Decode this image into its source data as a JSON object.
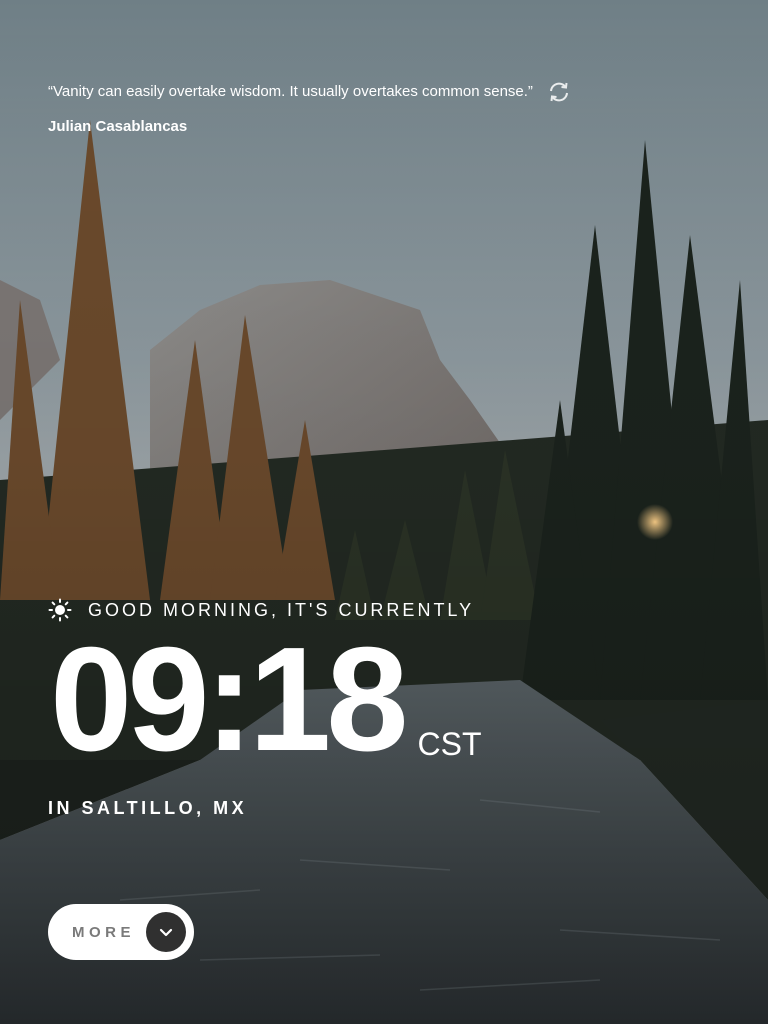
{
  "quote": {
    "text": "“Vanity can easily overtake wisdom. It usually overtakes common sense.”",
    "author": "Julian Casablancas"
  },
  "clock": {
    "greeting": "GOOD MORNING, IT'S CURRENTLY",
    "time": "09:18",
    "timezone": "CST",
    "location": "IN SALTILLO, MX"
  },
  "more_button": {
    "label": "MORE"
  },
  "icons": {
    "refresh": "refresh-icon",
    "greeting": "sun-icon",
    "more": "chevron-down-icon"
  },
  "colors": {
    "text": "#ffffff",
    "button_bg": "#ffffff",
    "button_label": "#7a7a7a",
    "button_circle": "#303030"
  }
}
